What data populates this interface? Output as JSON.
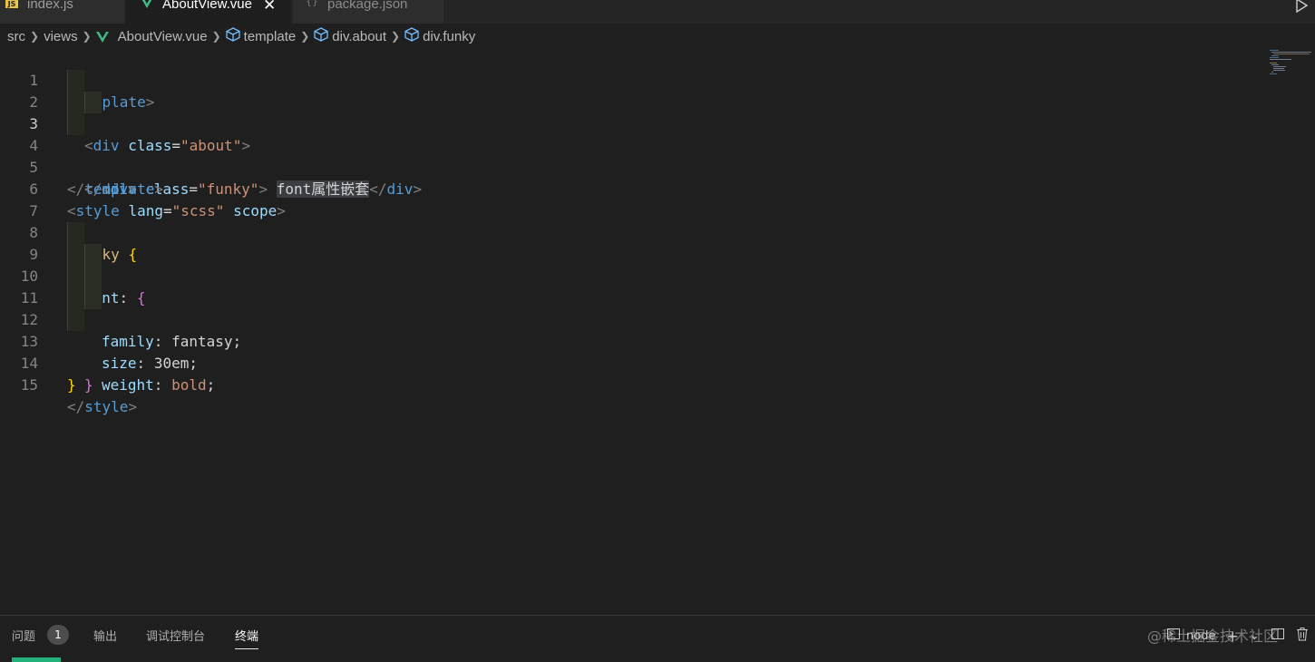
{
  "tabs": [
    {
      "label": "index.js",
      "icon": "js-file-icon"
    },
    {
      "label": "AboutView.vue",
      "icon": "vue-file-icon",
      "active": true
    },
    {
      "label": "package.json",
      "icon": "json-file-icon"
    }
  ],
  "breadcrumb": {
    "src": "src",
    "views": "views",
    "file": "AboutView.vue",
    "template": "template",
    "div_about": "div.about",
    "div_funky": "div.funky"
  },
  "editor": {
    "active_line": 3,
    "lines": [
      {
        "n": "1"
      },
      {
        "n": "2"
      },
      {
        "n": "3"
      },
      {
        "n": "4"
      },
      {
        "n": "5"
      },
      {
        "n": "6"
      },
      {
        "n": "7"
      },
      {
        "n": "8"
      },
      {
        "n": "9"
      },
      {
        "n": "10"
      },
      {
        "n": "11"
      },
      {
        "n": "12"
      },
      {
        "n": "13"
      },
      {
        "n": "14"
      },
      {
        "n": "15"
      }
    ],
    "code": {
      "l1": {
        "lt": "<",
        "tag": "template",
        "gt": ">"
      },
      "l2": {
        "lt": "<",
        "tag": "div",
        "attr": "class",
        "eq": "=",
        "str": "\"about\"",
        "gt": ">"
      },
      "l3": {
        "lt": "<",
        "tag": "div",
        "attr": "class",
        "eq": "=",
        "str": "\"funky\"",
        "gt": ">",
        "text": "font属性嵌套",
        "lt2": "</",
        "tag2": "div",
        "gt2": ">"
      },
      "l4": {
        "lt": "</",
        "tag": "div",
        "gt": ">"
      },
      "l5": {
        "lt": "</",
        "tag": "template",
        "gt": ">"
      },
      "l6": {
        "lt": "<",
        "tag": "style",
        "attr": "lang",
        "eq": "=",
        "str": "\"scss\"",
        "attr2": "scope",
        "gt": ">"
      },
      "l8": {
        "sel": ".funky",
        "brace": "{"
      },
      "l9": {
        "prop": "font",
        "colon": ":",
        "brace": "{"
      },
      "l10": {
        "prop": "family",
        "colon": ":",
        "val": "fantasy",
        "semi": ";"
      },
      "l11": {
        "prop": "size",
        "colon": ":",
        "val": "30em",
        "semi": ";"
      },
      "l12": {
        "prop": "weight",
        "colon": ":",
        "val": "bold",
        "semi": ";"
      },
      "l13": {
        "brace": "}"
      },
      "l14": {
        "brace": "}"
      },
      "l15": {
        "lt": "</",
        "tag": "style",
        "gt": ">"
      }
    }
  },
  "panel": {
    "problems": "问题",
    "problems_count": "1",
    "output": "输出",
    "debug_console": "调试控制台",
    "terminal": "终端",
    "terminal_name": "node",
    "plus": "+",
    "chevron": "⌄",
    "watermark": "@稀土掘金技术社区"
  },
  "colors": {
    "editor_bg": "#1f1f1f",
    "tag": "#569cd6",
    "attr": "#9cdcfe",
    "string": "#ce9178",
    "brace": "#ffd700",
    "vue_green": "#41b883"
  }
}
